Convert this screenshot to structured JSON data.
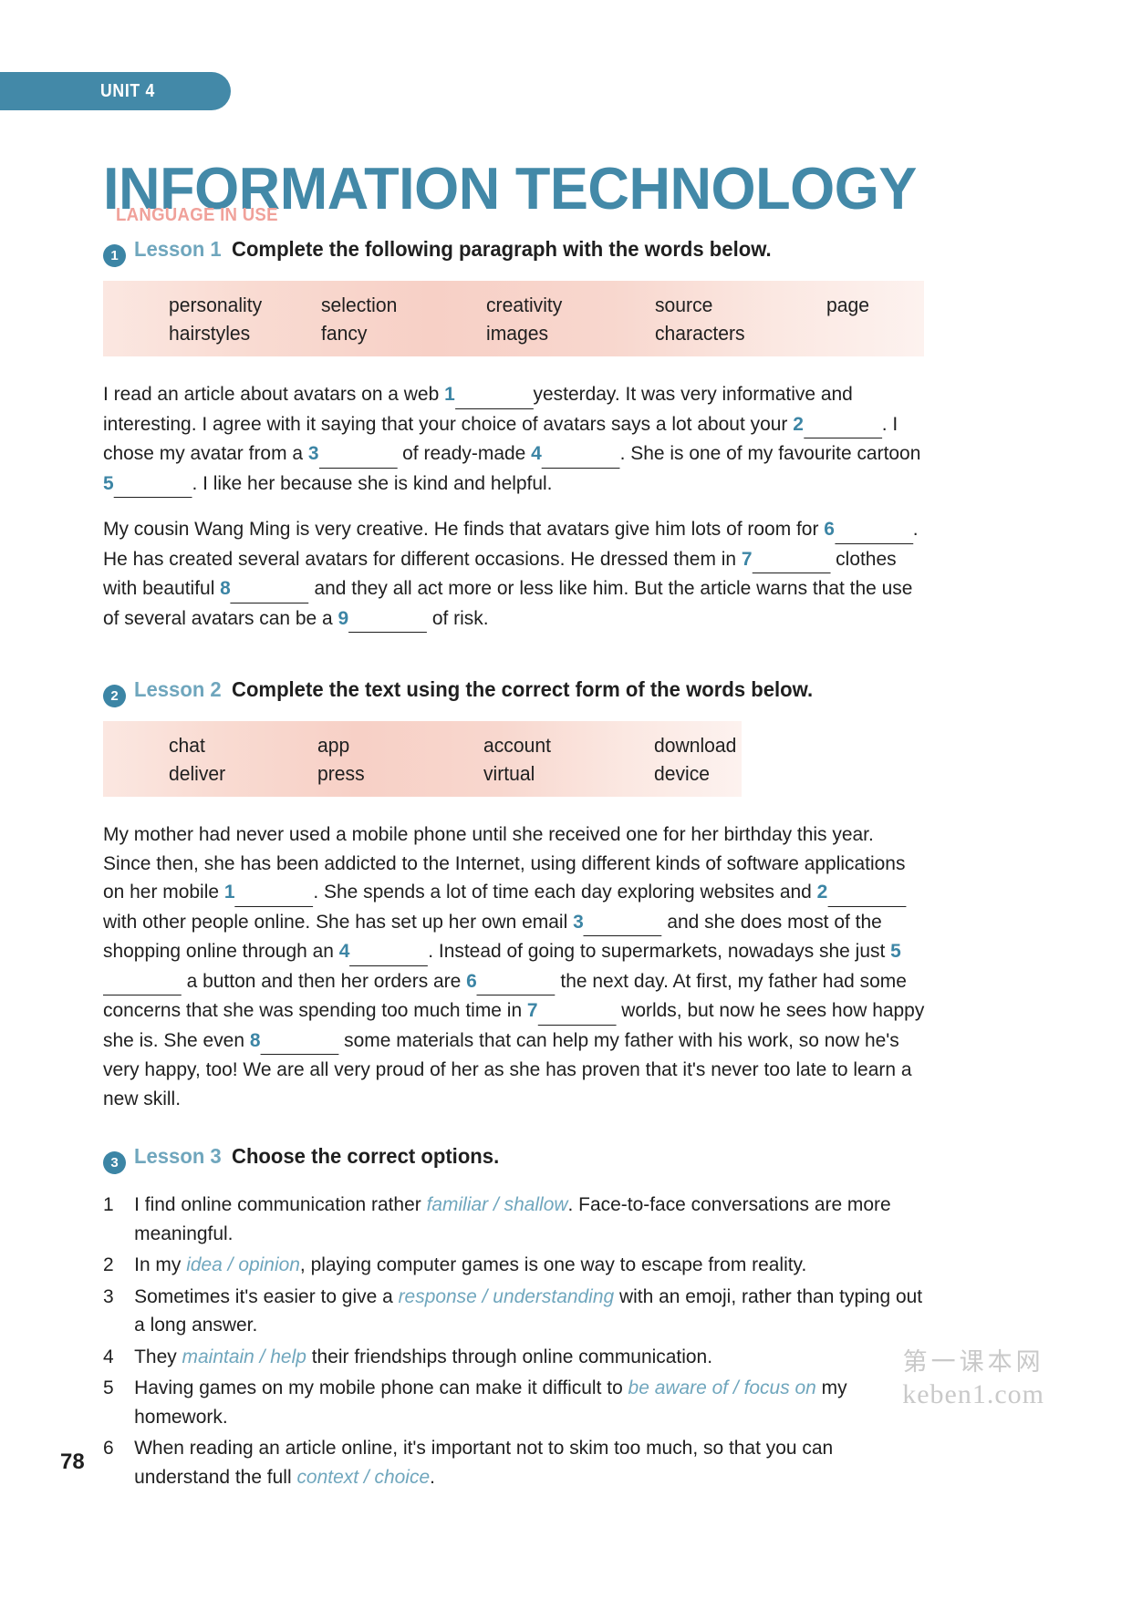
{
  "unit": {
    "tab_label": "UNIT 4",
    "title": "INFORMATION TECHNOLOGY"
  },
  "section": {
    "label": "LANGUAGE IN USE"
  },
  "exercises": [
    {
      "number": "1",
      "lesson": "Lesson 1",
      "instruction": "Complete the following paragraph with the words below.",
      "wordbank_rows": [
        [
          "personality",
          "selection",
          "creativity",
          "source",
          "page"
        ],
        [
          "hairstyles",
          "fancy",
          "images",
          "characters",
          ""
        ]
      ],
      "paragraphs": [
        {
          "parts": [
            {
              "t": "text",
              "v": "I read an article about avatars on a web "
            },
            {
              "t": "num",
              "v": "1"
            },
            {
              "t": "blank"
            },
            {
              "t": "text",
              "v": "yesterday. It was very informative and interesting. I agree with it saying that your choice of avatars says a lot about your "
            },
            {
              "t": "num",
              "v": "2"
            },
            {
              "t": "blank"
            },
            {
              "t": "text",
              "v": ". I chose my avatar from a "
            },
            {
              "t": "num",
              "v": "3"
            },
            {
              "t": "blank"
            },
            {
              "t": "text",
              "v": " of ready-made "
            },
            {
              "t": "num",
              "v": "4"
            },
            {
              "t": "blank"
            },
            {
              "t": "text",
              "v": ". She is one of my favourite cartoon "
            },
            {
              "t": "num",
              "v": "5"
            },
            {
              "t": "blank"
            },
            {
              "t": "text",
              "v": ". I like her because she is kind and helpful."
            }
          ]
        },
        {
          "parts": [
            {
              "t": "text",
              "v": "My cousin Wang Ming is very creative. He finds that avatars give him lots of room for "
            },
            {
              "t": "num",
              "v": "6"
            },
            {
              "t": "blank"
            },
            {
              "t": "text",
              "v": ". He has created several avatars for different occasions. He dressed them in "
            },
            {
              "t": "num",
              "v": "7"
            },
            {
              "t": "blank"
            },
            {
              "t": "text",
              "v": " clothes with beautiful "
            },
            {
              "t": "num",
              "v": "8"
            },
            {
              "t": "blank"
            },
            {
              "t": "text",
              "v": " and they all act more or less like him. But the article warns that the use of several avatars can be a "
            },
            {
              "t": "num",
              "v": "9"
            },
            {
              "t": "blank"
            },
            {
              "t": "text",
              "v": " of risk."
            }
          ]
        }
      ]
    },
    {
      "number": "2",
      "lesson": "Lesson 2",
      "instruction": "Complete the text using the correct form of the words below.",
      "wordbank_rows": [
        [
          "chat",
          "app",
          "account",
          "download"
        ],
        [
          "deliver",
          "press",
          "virtual",
          "device"
        ]
      ],
      "paragraphs": [
        {
          "parts": [
            {
              "t": "text",
              "v": "My mother had never used a mobile phone until she received one for her birthday this year. Since then, she has been addicted to the Internet, using different kinds of software applications on her mobile "
            },
            {
              "t": "num",
              "v": "1"
            },
            {
              "t": "blank"
            },
            {
              "t": "text",
              "v": ". She spends a lot of time each day exploring websites and "
            },
            {
              "t": "num",
              "v": "2"
            },
            {
              "t": "blank"
            },
            {
              "t": "text",
              "v": " with other people online. She has set up her own email "
            },
            {
              "t": "num",
              "v": "3"
            },
            {
              "t": "blank"
            },
            {
              "t": "text",
              "v": " and she does most of the shopping online through an "
            },
            {
              "t": "num",
              "v": "4"
            },
            {
              "t": "blank"
            },
            {
              "t": "text",
              "v": ". Instead of going to supermarkets, nowadays she just "
            },
            {
              "t": "num",
              "v": "5"
            },
            {
              "t": "blank"
            },
            {
              "t": "text",
              "v": " a button and then her orders are "
            },
            {
              "t": "num",
              "v": "6"
            },
            {
              "t": "blank"
            },
            {
              "t": "text",
              "v": " the next day. At first, my father had some concerns that she was spending too much time in "
            },
            {
              "t": "num",
              "v": "7"
            },
            {
              "t": "blank"
            },
            {
              "t": "text",
              "v": " worlds, but now he sees how happy she is. She even "
            },
            {
              "t": "num",
              "v": "8"
            },
            {
              "t": "blank"
            },
            {
              "t": "text",
              "v": " some materials that can help my father with his work, so now he's very happy, too! We are all very proud of her as she has proven that it's never too late to learn a new skill."
            }
          ]
        }
      ]
    },
    {
      "number": "3",
      "lesson": "Lesson 3",
      "instruction": "Choose the correct options.",
      "questions": [
        {
          "number": "1",
          "parts": [
            {
              "t": "text",
              "v": "I find online communication rather "
            },
            {
              "t": "opt",
              "v": "familiar / shallow"
            },
            {
              "t": "text",
              "v": ". Face-to-face conversations are more meaningful."
            }
          ]
        },
        {
          "number": "2",
          "parts": [
            {
              "t": "text",
              "v": "In my "
            },
            {
              "t": "opt",
              "v": "idea / opinion"
            },
            {
              "t": "text",
              "v": ", playing computer games is one way to escape from reality."
            }
          ]
        },
        {
          "number": "3",
          "parts": [
            {
              "t": "text",
              "v": "Sometimes it's easier to give a "
            },
            {
              "t": "opt",
              "v": "response / understanding"
            },
            {
              "t": "text",
              "v": " with an emoji, rather than typing out a long answer."
            }
          ]
        },
        {
          "number": "4",
          "parts": [
            {
              "t": "text",
              "v": "They "
            },
            {
              "t": "opt",
              "v": "maintain / help"
            },
            {
              "t": "text",
              "v": " their friendships through online communication."
            }
          ]
        },
        {
          "number": "5",
          "parts": [
            {
              "t": "text",
              "v": "Having games on my mobile phone can make it difficult to "
            },
            {
              "t": "opt",
              "v": "be aware of / focus on"
            },
            {
              "t": "text",
              "v": " my homework."
            }
          ]
        },
        {
          "number": "6",
          "parts": [
            {
              "t": "text",
              "v": "When reading an article online, it's important not to skim too much, so that you can understand the full "
            },
            {
              "t": "opt",
              "v": "context / choice"
            },
            {
              "t": "text",
              "v": "."
            }
          ]
        }
      ]
    }
  ],
  "footer": {
    "page_number": "78",
    "watermark_cn": "第一课本网",
    "watermark_en": "keben1.com"
  },
  "colors": {
    "brand_blue": "#4389a8",
    "accent_pink": "#f0a19a",
    "lesson_blue": "#6fa6bd",
    "blank_number": "#3c85a5",
    "wordbank_bg": "#f7d0c6"
  }
}
